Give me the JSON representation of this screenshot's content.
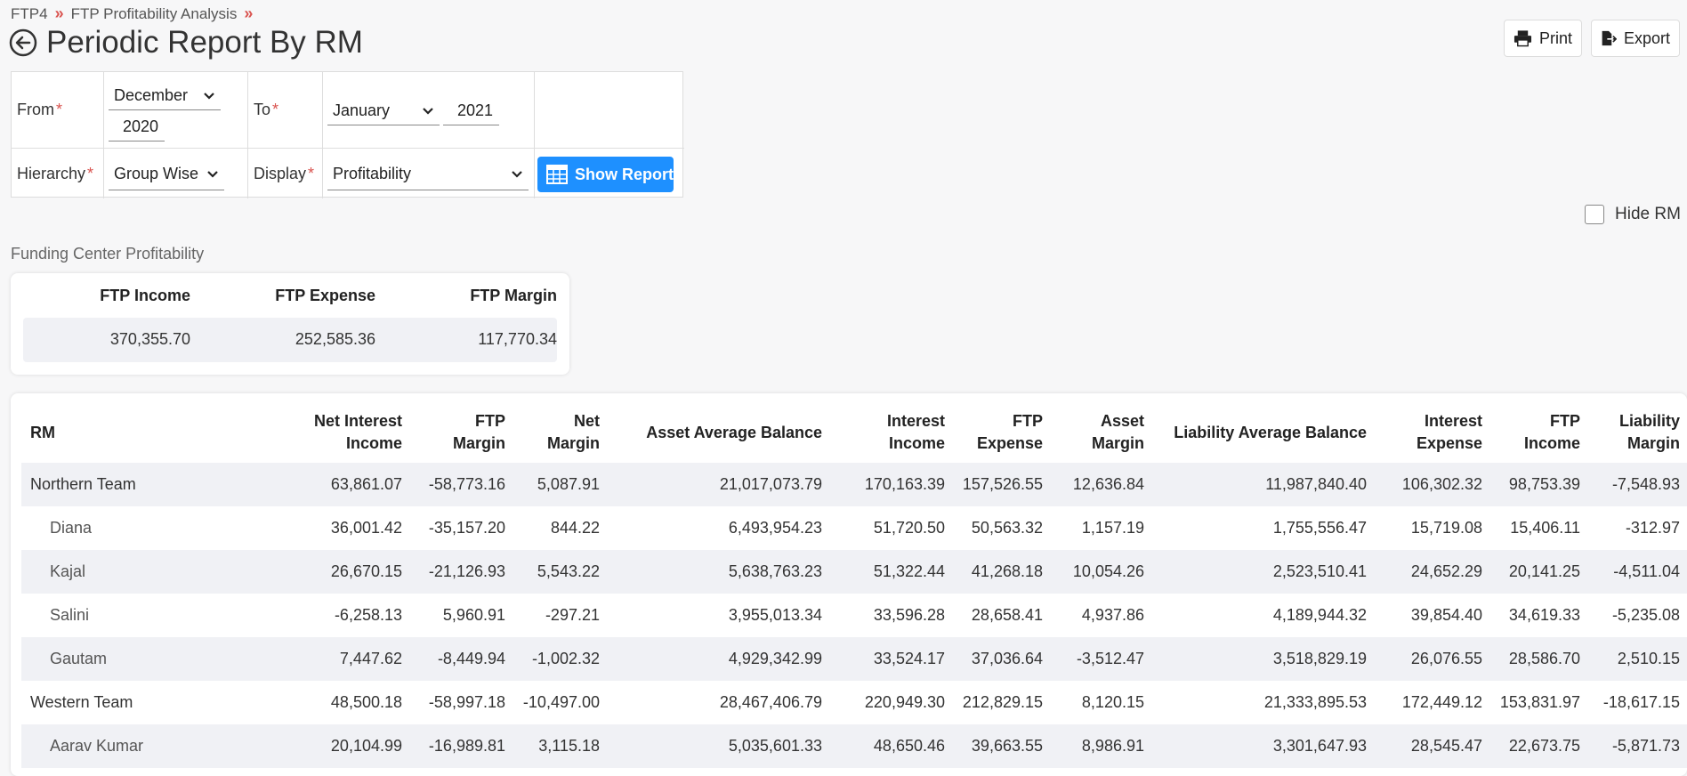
{
  "breadcrumb": [
    "FTP4",
    "FTP Profitability Analysis"
  ],
  "page_title": "Periodic Report By RM",
  "toolbar": {
    "print_label": "Print",
    "export_label": "Export"
  },
  "filters": {
    "from_label": "From",
    "from_month": "December",
    "from_year": "2020",
    "to_label": "To",
    "to_month": "January",
    "to_year": "2021",
    "hierarchy_label": "Hierarchy",
    "hierarchy_value": "Group Wise",
    "display_label": "Display",
    "display_value": "Profitability",
    "required_mark": "*",
    "show_report_label": "Show Report"
  },
  "hide_rm_label": "Hide RM",
  "funding_center": {
    "title": "Funding Center Profitability",
    "headers": [
      "FTP Income",
      "FTP Expense",
      "FTP Margin"
    ],
    "values": [
      "370,355.70",
      "252,585.36",
      "117,770.34"
    ]
  },
  "report": {
    "headers": [
      [
        "RM"
      ],
      [
        "Net Interest",
        "Income"
      ],
      [
        "FTP",
        "Margin"
      ],
      [
        "Net",
        "Margin"
      ],
      [
        "Asset Average Balance"
      ],
      [
        "Interest",
        "Income"
      ],
      [
        "FTP",
        "Expense"
      ],
      [
        "Asset",
        "Margin"
      ],
      [
        "Liability Average Balance"
      ],
      [
        "Interest",
        "Expense"
      ],
      [
        "FTP",
        "Income"
      ],
      [
        "Liability",
        "Margin"
      ]
    ],
    "rows": [
      {
        "name": "Northern Team",
        "child": false,
        "cells": [
          "63,861.07",
          "-58,773.16",
          "5,087.91",
          "21,017,073.79",
          "170,163.39",
          "157,526.55",
          "12,636.84",
          "11,987,840.40",
          "106,302.32",
          "98,753.39",
          "-7,548.93"
        ]
      },
      {
        "name": "Diana",
        "child": true,
        "cells": [
          "36,001.42",
          "-35,157.20",
          "844.22",
          "6,493,954.23",
          "51,720.50",
          "50,563.32",
          "1,157.19",
          "1,755,556.47",
          "15,719.08",
          "15,406.11",
          "-312.97"
        ]
      },
      {
        "name": "Kajal",
        "child": true,
        "cells": [
          "26,670.15",
          "-21,126.93",
          "5,543.22",
          "5,638,763.23",
          "51,322.44",
          "41,268.18",
          "10,054.26",
          "2,523,510.41",
          "24,652.29",
          "20,141.25",
          "-4,511.04"
        ]
      },
      {
        "name": "Salini",
        "child": true,
        "cells": [
          "-6,258.13",
          "5,960.91",
          "-297.21",
          "3,955,013.34",
          "33,596.28",
          "28,658.41",
          "4,937.86",
          "4,189,944.32",
          "39,854.40",
          "34,619.33",
          "-5,235.08"
        ]
      },
      {
        "name": "Gautam",
        "child": true,
        "cells": [
          "7,447.62",
          "-8,449.94",
          "-1,002.32",
          "4,929,342.99",
          "33,524.17",
          "37,036.64",
          "-3,512.47",
          "3,518,829.19",
          "26,076.55",
          "28,586.70",
          "2,510.15"
        ]
      },
      {
        "name": "Western Team",
        "child": false,
        "cells": [
          "48,500.18",
          "-58,997.18",
          "-10,497.00",
          "28,467,406.79",
          "220,949.30",
          "212,829.15",
          "8,120.15",
          "21,333,895.53",
          "172,449.12",
          "153,831.97",
          "-18,617.15"
        ]
      },
      {
        "name": "Aarav Kumar",
        "child": true,
        "cells": [
          "20,104.99",
          "-16,989.81",
          "3,115.18",
          "5,035,601.33",
          "48,650.46",
          "39,663.55",
          "8,986.91",
          "3,301,647.93",
          "28,545.47",
          "22,673.75",
          "-5,871.73"
        ]
      }
    ]
  }
}
